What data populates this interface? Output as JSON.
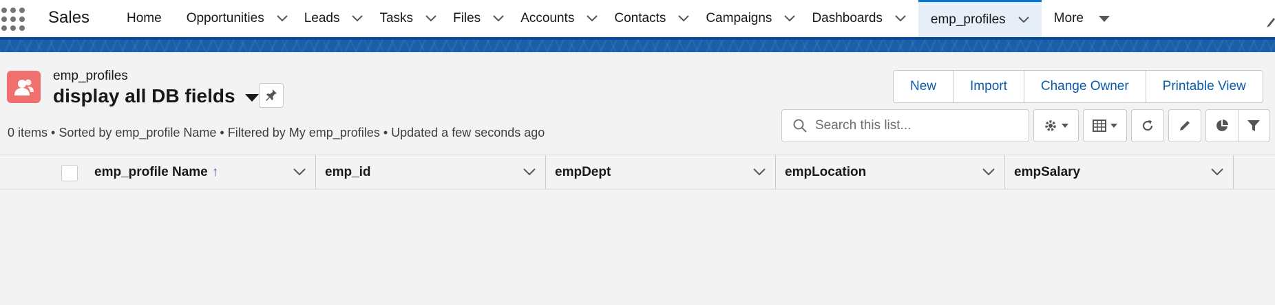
{
  "nav": {
    "app_name": "Sales",
    "items": [
      {
        "label": "Home",
        "has_menu": false
      },
      {
        "label": "Opportunities",
        "has_menu": true
      },
      {
        "label": "Leads",
        "has_menu": true
      },
      {
        "label": "Tasks",
        "has_menu": true
      },
      {
        "label": "Files",
        "has_menu": true
      },
      {
        "label": "Accounts",
        "has_menu": true
      },
      {
        "label": "Contacts",
        "has_menu": true
      },
      {
        "label": "Campaigns",
        "has_menu": true
      },
      {
        "label": "Dashboards",
        "has_menu": true
      },
      {
        "label": "emp_profiles",
        "has_menu": true,
        "active": true
      }
    ],
    "more_label": "More"
  },
  "header": {
    "object_label": "emp_profiles",
    "view_title": "display all DB fields",
    "meta": "0 items • Sorted by emp_profile Name • Filtered by My emp_profiles • Updated a few seconds ago"
  },
  "actions": {
    "new": "New",
    "import": "Import",
    "change_owner": "Change Owner",
    "printable_view": "Printable View"
  },
  "search": {
    "placeholder": "Search this list..."
  },
  "table": {
    "columns": [
      {
        "label": "emp_profile Name",
        "sorted": "asc",
        "sort_glyph": "↑"
      },
      {
        "label": "emp_id"
      },
      {
        "label": "empDept"
      },
      {
        "label": "empLocation"
      },
      {
        "label": "empSalary"
      }
    ],
    "rows": []
  },
  "colors": {
    "brand_band": "#1b5faa",
    "active_tab_bg": "#e6eef8",
    "accent": "#0176d3",
    "object_icon": "#f0706f",
    "link_blue": "#0b5cab"
  }
}
